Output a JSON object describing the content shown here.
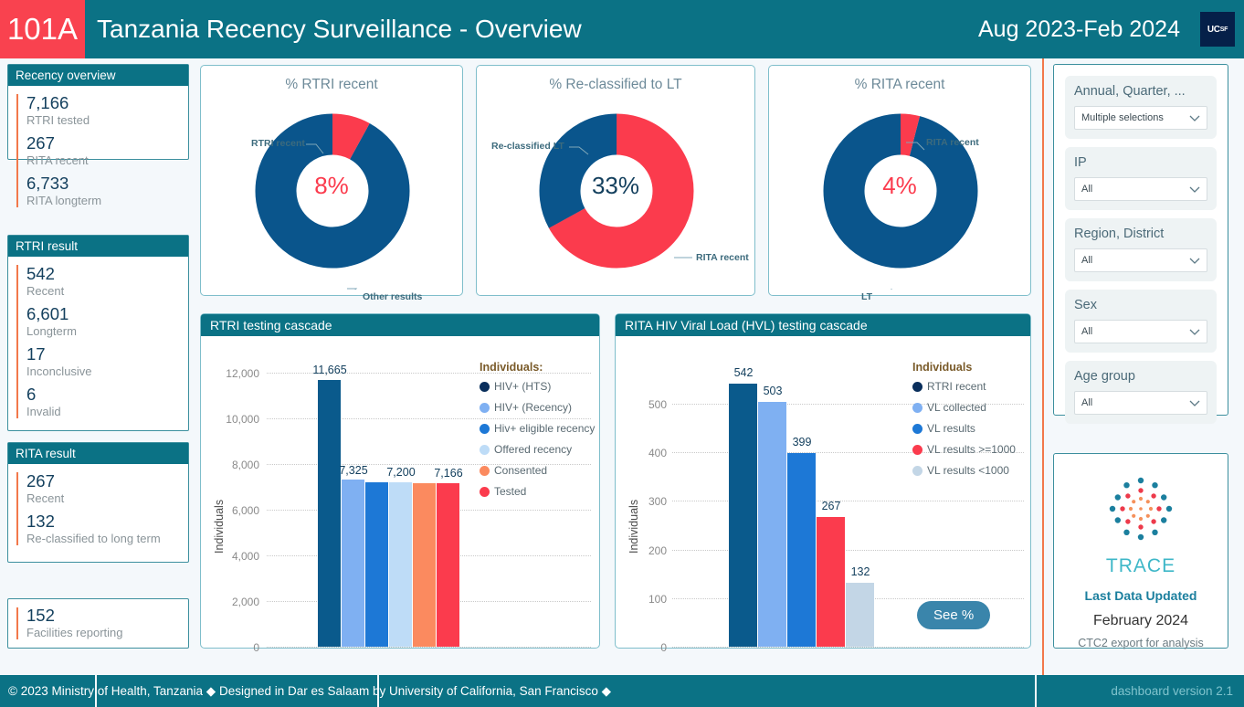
{
  "header": {
    "badge": "101A",
    "title": "Tanzania Recency Surveillance - Overview",
    "period": "Aug 2023-Feb 2024",
    "logo_text": "UCSF",
    "logo_icon": "ucsf-logo-icon",
    "bg_color": "#0b7285",
    "badge_color": "#f9424f"
  },
  "kpi_cards": [
    {
      "title": "Recency overview",
      "rows": [
        {
          "value": "7,166",
          "label": "RTRI tested"
        },
        {
          "value": "267",
          "label": "RITA recent"
        },
        {
          "value": "6,733",
          "label": "RITA longterm"
        }
      ]
    },
    {
      "title": "RTRI result",
      "rows": [
        {
          "value": "542",
          "label": "Recent"
        },
        {
          "value": "6,601",
          "label": "Longterm"
        },
        {
          "value": "17",
          "label": "Inconclusive"
        },
        {
          "value": "6",
          "label": "Invalid"
        }
      ]
    },
    {
      "title": "RITA result",
      "rows": [
        {
          "value": "267",
          "label": "Recent"
        },
        {
          "value": "132",
          "label": "Re-classified to long term"
        }
      ]
    },
    {
      "title": "",
      "rows": [
        {
          "value": "152",
          "label": "Facilities reporting"
        }
      ]
    }
  ],
  "chart_data": [
    {
      "type": "pie",
      "title": "% RTRI recent",
      "center_label": "8%",
      "center_color": "#fb3b4d",
      "labels": [
        "RTRI recent",
        "Other results"
      ],
      "values": [
        8,
        92
      ],
      "colors": [
        "#fb3b4d",
        "#0a558c"
      ],
      "legend": "callouts"
    },
    {
      "type": "pie",
      "title": "% Re-classified to LT",
      "center_label": "33%",
      "center_color": "#14405e",
      "labels": [
        "Re-classified LT",
        "RITA recent"
      ],
      "values": [
        33,
        67
      ],
      "colors": [
        "#0a558c",
        "#fb3b4d"
      ],
      "legend": "callouts"
    },
    {
      "type": "pie",
      "title": "% RITA recent",
      "center_label": "4%",
      "center_color": "#fb3b4d",
      "labels": [
        "RITA recent",
        "LT"
      ],
      "values": [
        4,
        96
      ],
      "colors": [
        "#fb3b4d",
        "#0a558c"
      ],
      "legend": "callouts"
    },
    {
      "type": "bar",
      "title": "RTRI testing cascade",
      "ylabel": "Individuals",
      "xlabel": "",
      "ylim": [
        0,
        12000
      ],
      "yticks": [
        "0",
        "2,000",
        "4,000",
        "6,000",
        "8,000",
        "10,000",
        "12,000"
      ],
      "ytick_values": [
        0,
        2000,
        4000,
        6000,
        8000,
        10000,
        12000
      ],
      "grid": true,
      "legend_title": "Individuals:",
      "categories": [
        "HIV+ (HTS)",
        "HIV+ (Recency)",
        "Hiv+ eligible recency",
        "Offered recency",
        "Consented",
        "Tested"
      ],
      "values": [
        11665,
        7325,
        7200,
        7200,
        7166,
        7166
      ],
      "value_labels": [
        "11,665",
        "7,325",
        "",
        "7,200",
        "",
        "7,166"
      ],
      "colors": [
        "#0a5a8c",
        "#7fb0f2",
        "#1d78d6",
        "#bedcf7",
        "#fb8a5f",
        "#fb3b4d"
      ]
    },
    {
      "type": "bar",
      "title": "RITA HIV Viral Load (HVL) testing cascade",
      "ylabel": "Individuals",
      "xlabel": "",
      "ylim": [
        0,
        560
      ],
      "yticks": [
        "0",
        "100",
        "200",
        "300",
        "400",
        "500"
      ],
      "ytick_values": [
        0,
        100,
        200,
        300,
        400,
        500
      ],
      "grid": true,
      "legend_title": "Individuals",
      "categories": [
        "RTRI recent",
        "VL collected",
        "VL results",
        "VL results >=1000",
        "VL results <1000"
      ],
      "values": [
        542,
        503,
        399,
        267,
        132
      ],
      "value_labels": [
        "542",
        "503",
        "399",
        "267",
        "132"
      ],
      "colors": [
        "#0a5a8c",
        "#7fb0f2",
        "#1d78d6",
        "#fb3b4d",
        "#c3d6e6"
      ],
      "button_label": "See %"
    }
  ],
  "filters": [
    {
      "label": "Annual, Quarter, ...",
      "value": "Multiple selections"
    },
    {
      "label": "IP",
      "value": "All"
    },
    {
      "label": "Region, District",
      "value": "All"
    },
    {
      "label": "Sex",
      "value": "All"
    },
    {
      "label": "Age group",
      "value": "All"
    }
  ],
  "brand": {
    "logo_icon": "trace-starburst-logo-icon",
    "name": "TRACE",
    "updated_label": "Last Data Updated",
    "updated_value": "February 2024",
    "note": "CTC2 export for analysis"
  },
  "footer": {
    "left": "© 2023 Ministry of Health, Tanzania ◆ Designed in Dar es Salaam by University of California, San Francisco ◆",
    "right": "dashboard version 2.1"
  }
}
